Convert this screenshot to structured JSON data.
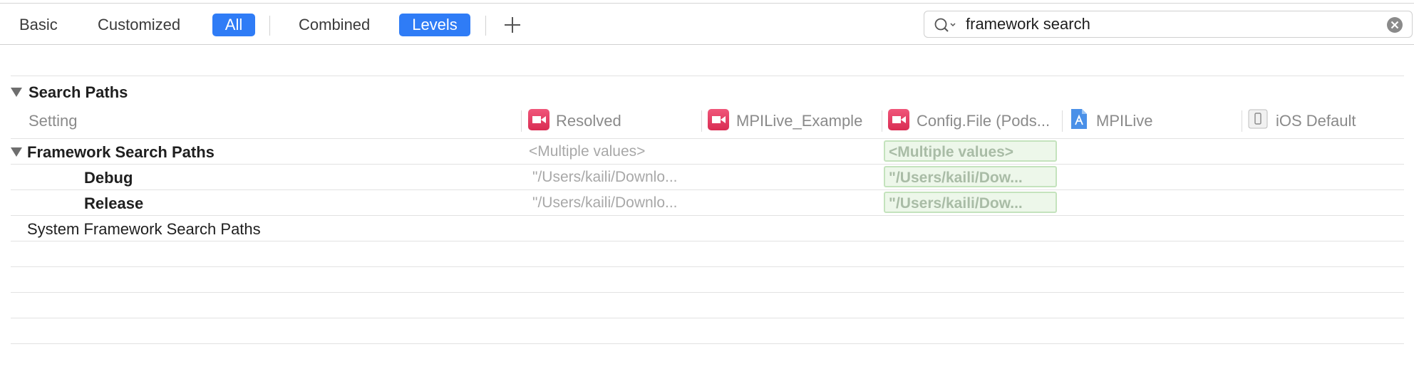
{
  "toolbar": {
    "tabs": [
      "Basic",
      "Customized",
      "All"
    ],
    "modes": [
      "Combined",
      "Levels"
    ],
    "add_icon": "plus-icon"
  },
  "search": {
    "value": "framework search",
    "icon": "magnifier-dropdown-icon",
    "clear_icon": "clear-circle-x-icon"
  },
  "section": {
    "title": "Search Paths",
    "setting_header": "Setting",
    "columns": [
      {
        "label": "Resolved",
        "icon": "target-app-icon"
      },
      {
        "label": "MPILive_Example",
        "icon": "target-app-icon"
      },
      {
        "label": "Config.File (Pods...",
        "icon": "target-app-icon"
      },
      {
        "label": "MPILive",
        "icon": "project-file-icon"
      },
      {
        "label": "iOS Default",
        "icon": "platform-default-icon"
      }
    ]
  },
  "rows": {
    "framework": {
      "label": "Framework Search Paths",
      "resolved": "<Multiple values>",
      "config": "<Multiple values>"
    },
    "debug": {
      "label": "Debug",
      "resolved": "\"/Users/kaili/Downlo...",
      "config": "\"/Users/kaili/Dow..."
    },
    "release": {
      "label": "Release",
      "resolved": "\"/Users/kaili/Downlo...",
      "config": "\"/Users/kaili/Dow..."
    },
    "system": {
      "label": "System Framework Search Paths"
    }
  },
  "colors": {
    "accent": "#2f7cf6",
    "target_icon": "#e23b62",
    "level_highlight": "#edf7ea"
  }
}
